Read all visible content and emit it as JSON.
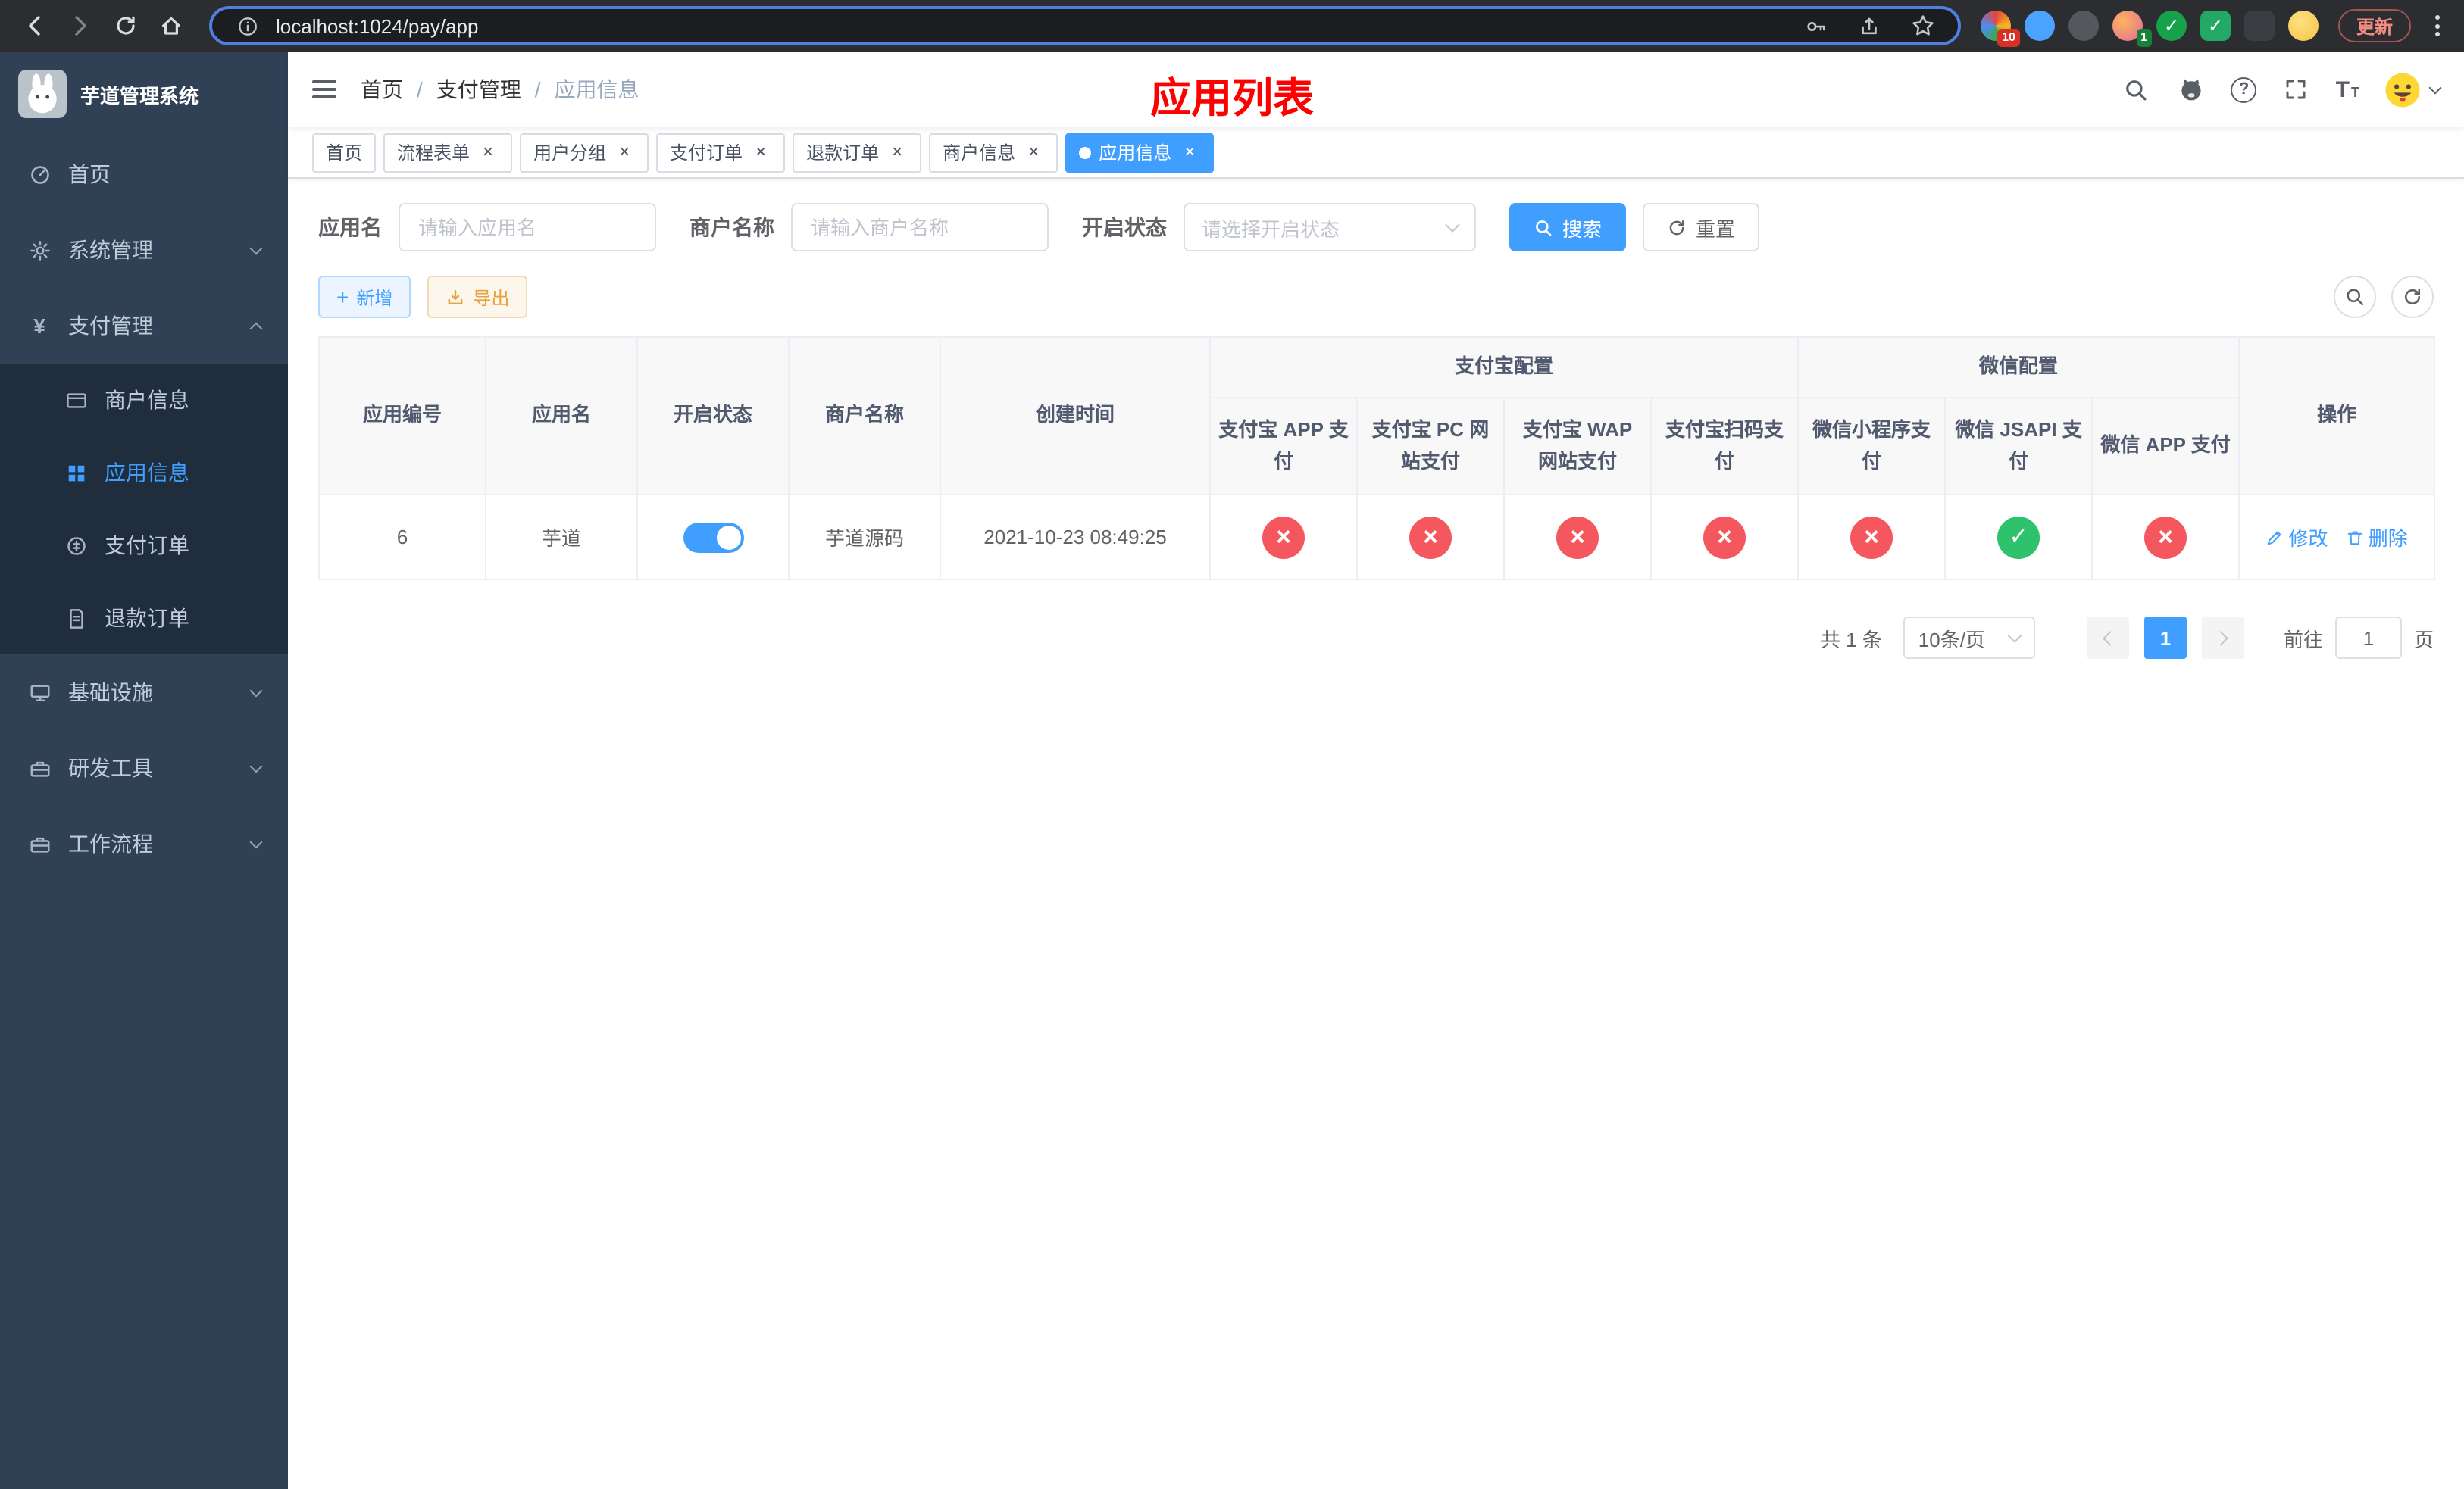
{
  "colors": {
    "accent": "#409eff",
    "accent_blue": "#4e7fe1",
    "danger": "#f5575e",
    "success": "#2dc26b",
    "overlay": "#ff0000"
  },
  "browser": {
    "url": "localhost:1024/pay/app",
    "update_button": "更新",
    "extension_badges": {
      "first": "10",
      "second": "1"
    }
  },
  "sidebar": {
    "app_title": "芋道管理系统",
    "menu": [
      {
        "label": "首页"
      },
      {
        "label": "系统管理"
      },
      {
        "label": "支付管理"
      },
      {
        "label": "基础设施"
      },
      {
        "label": "研发工具"
      },
      {
        "label": "工作流程"
      }
    ],
    "payment_submenu": [
      {
        "label": "商户信息"
      },
      {
        "label": "应用信息"
      },
      {
        "label": "支付订单"
      },
      {
        "label": "退款订单"
      }
    ]
  },
  "navbar": {
    "breadcrumb": [
      "首页",
      "支付管理",
      "应用信息"
    ],
    "page_overlay_title": "应用列表"
  },
  "tabs": [
    {
      "label": "首页"
    },
    {
      "label": "流程表单"
    },
    {
      "label": "用户分组"
    },
    {
      "label": "支付订单"
    },
    {
      "label": "退款订单"
    },
    {
      "label": "商户信息"
    },
    {
      "label": "应用信息"
    }
  ],
  "filters": {
    "app_name_label": "应用名",
    "app_name_placeholder": "请输入应用名",
    "merchant_label": "商户名称",
    "merchant_placeholder": "请输入商户名称",
    "status_label": "开启状态",
    "status_placeholder": "请选择开启状态",
    "search_button": "搜索",
    "reset_button": "重置"
  },
  "toolbar": {
    "add_button": "新增",
    "export_button": "导出"
  },
  "table": {
    "columns": {
      "app_id": "应用编号",
      "app_name": "应用名",
      "status": "开启状态",
      "merchant_name": "商户名称",
      "create_time": "创建时间",
      "alipay_group": "支付宝配置",
      "wechat_group": "微信配置",
      "actions": "操作"
    },
    "sub_columns": [
      "支付宝 APP 支付",
      "支付宝 PC 网站支付",
      "支付宝 WAP 网站支付",
      "支付宝扫码支付",
      "微信小程序支付",
      "微信 JSAPI 支付",
      "微信 APP 支付"
    ],
    "rows": [
      {
        "app_id": "6",
        "app_name": "芋道",
        "status_on": true,
        "merchant_name": "芋道源码",
        "create_time": "2021-10-23 08:49:25",
        "configs": [
          "off",
          "off",
          "off",
          "off",
          "off",
          "on",
          "off"
        ],
        "edit_action": "修改",
        "delete_action": "删除"
      }
    ]
  },
  "pagination": {
    "total_text": "共 1 条",
    "page_size": "10条/页",
    "current_page": "1",
    "goto_label": "前往",
    "goto_value": "1",
    "page_unit": "页"
  }
}
